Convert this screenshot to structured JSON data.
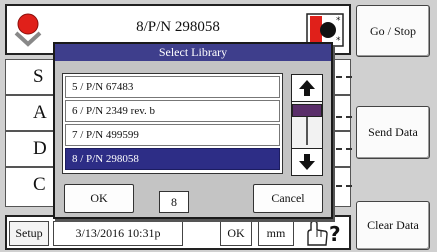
{
  "header": {
    "title": "8/P/N 298058",
    "status_icon": "red-indicator-icon",
    "mode_icon": "measurement-mode-icon"
  },
  "side_buttons": {
    "go_stop": "Go / Stop",
    "send_data": "Send Data",
    "clear_data": "Clear Data"
  },
  "background_rows": [
    "S",
    "A",
    "D",
    "C"
  ],
  "status_bar": {
    "setup": "Setup",
    "datetime": "3/13/2016 10:31p",
    "ok": "OK",
    "units": "mm",
    "help_icon": "touch-help-icon"
  },
  "dialog": {
    "title": "Select Library",
    "items": [
      "5 / P/N 67483",
      "6 / P/N 2349 rev. b",
      "7 / P/N 499599",
      "8 / P/N 298058"
    ],
    "selected_index": 3,
    "ok_label": "OK",
    "cancel_label": "Cancel",
    "selected_number": "8"
  },
  "colors": {
    "title_bar": "#3e3e8c",
    "selected_item": "#2d2d86",
    "indicator": "#e0201a",
    "scroll_thumb": "#5a2e6a"
  }
}
